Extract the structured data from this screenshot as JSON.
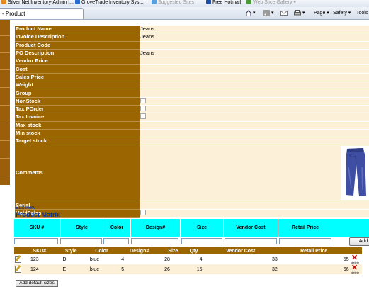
{
  "favorites": [
    {
      "label": "Silver Net Inventory-Admin I...",
      "color": "#e08a1e"
    },
    {
      "label": "GroveTrade Inventory Syst...",
      "color": "#2a6bd1"
    },
    {
      "label": "Suggested Sites",
      "color": "#5aa0e0",
      "dim": true
    },
    {
      "label": "Free Hotmail",
      "color": "#1d4fa8"
    },
    {
      "label": "Web Slice Gallery",
      "color": "#4a9a3a",
      "dim": true
    }
  ],
  "tab": {
    "title": "- Product"
  },
  "command_bar": {
    "page_label": "Page",
    "safety_label": "Safety",
    "tools_label": "Tools"
  },
  "product": {
    "fields": [
      {
        "label": "Product Name",
        "value": "Jeans"
      },
      {
        "label": "Invoice Description",
        "value": "Jeans"
      },
      {
        "label": "Product Code",
        "value": ""
      },
      {
        "label": "PO Description",
        "value": "Jeans"
      },
      {
        "label": "Vendor Price",
        "value": ""
      },
      {
        "label": "Cost",
        "value": ""
      },
      {
        "label": "Sales Price",
        "value": ""
      },
      {
        "label": "Weight",
        "value": ""
      },
      {
        "label": "Group",
        "value": ""
      },
      {
        "label": "NonStock",
        "value": "",
        "checkbox": true
      },
      {
        "label": "Tax POrder",
        "value": "",
        "checkbox": true
      },
      {
        "label": "Tax Invoice",
        "value": "",
        "checkbox": true
      },
      {
        "label": "Max stock",
        "value": ""
      },
      {
        "label": "Min stock",
        "value": ""
      },
      {
        "label": "Target stock",
        "value": ""
      }
    ],
    "comments_label": "Comments",
    "serial_label": "Serial",
    "holdsales_label": "HoldSales"
  },
  "links": {
    "edit": "Edit",
    "new": "New"
  },
  "matrix": {
    "title": "Product Matrix",
    "headers": [
      "SKU #",
      "Style",
      "Color",
      "Design#",
      "Size",
      "Vendor Cost",
      "Retail Price"
    ],
    "add_label": "Add"
  },
  "grid": {
    "headers": [
      "",
      "SKU#",
      "Style",
      "Color",
      "Design#",
      "Size",
      "Qty",
      "Vendor Cost",
      "Retail Price",
      ""
    ],
    "rows": [
      {
        "sku": "123",
        "style": "D",
        "color": "blue",
        "design": "4",
        "size": "28",
        "qty": "4",
        "vendor_cost": "33",
        "retail_price": "55"
      },
      {
        "sku": "124",
        "style": "E",
        "color": "blue",
        "design": "5",
        "size": "26",
        "qty": "15",
        "vendor_cost": "32",
        "retail_price": "66"
      }
    ],
    "delete_label": "delete"
  },
  "add_default_sizes_label": "Add default sizes"
}
